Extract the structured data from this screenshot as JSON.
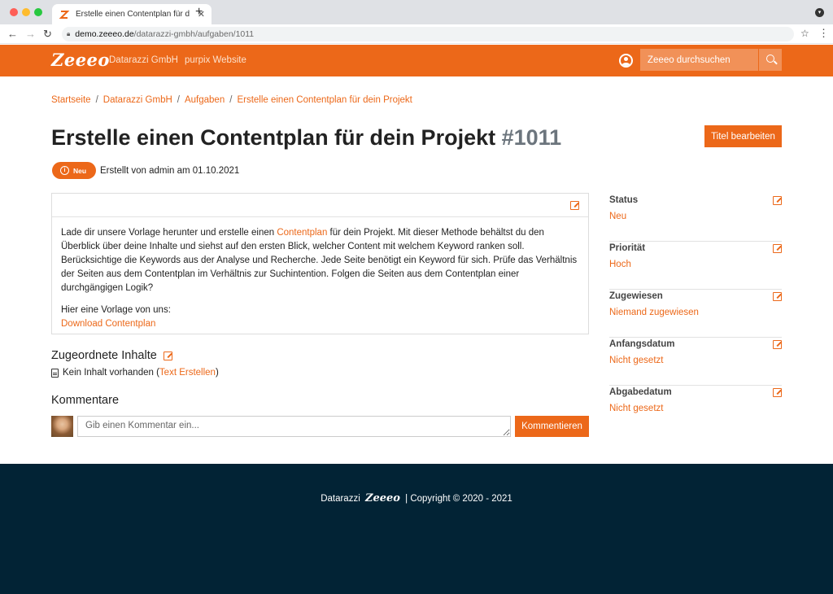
{
  "browser": {
    "tab_title": "Erstelle einen Contentplan für d",
    "tab_close": "✕",
    "new_tab": "+",
    "url_host": "demo.zeeeo.de",
    "url_path": "/datarazzi-gmbh/aufgaben/1011",
    "colors": {
      "close": "#fe5f57",
      "minimize": "#febc2e",
      "maximize": "#28c840"
    }
  },
  "header": {
    "logo": "Zeeeo",
    "nav": [
      "Datarazzi GmbH",
      "purpix Website"
    ],
    "search_placeholder": "Zeeeo durchsuchen",
    "accent_color": "#ec6819"
  },
  "breadcrumb": [
    "Startseite",
    "Datarazzi GmbH",
    "Aufgaben",
    "Erstelle einen Contentplan für dein Projekt"
  ],
  "task": {
    "title": "Erstelle einen Contentplan für dein Projekt",
    "number": "#1011",
    "edit_title_label": "Titel bearbeiten",
    "status_badge": "Neu",
    "created_text": "Erstellt von admin am 01.10.2021"
  },
  "description": {
    "intro_before": "Lade dir unsere Vorlage herunter und erstelle einen ",
    "intro_link": "Contentplan",
    "intro_after": " für dein Projekt. Mit dieser Methode behältst du den Überblick über deine Inhalte und siehst auf den ersten Blick, welcher Content mit welchem Keyword ranken soll. Berücksichtige die Keywords aus der Analyse und Recherche. Jede Seite benötigt ein Keyword für sich. Prüfe das Verhältnis der Seiten aus dem Contentplan im Verhältnis zur Suchintention. Folgen die Seiten aus dem Contentplan einer durchgängigen Logik?",
    "vorlage_text": "Hier eine Vorlage von uns:",
    "download_link": "Download Contentplan"
  },
  "inhalte": {
    "heading": "Zugeordnete Inhalte",
    "empty_text": "Kein Inhalt vorhanden (",
    "create_link": "Text Erstellen",
    "close_paren": ")"
  },
  "comments": {
    "heading": "Kommentare",
    "placeholder": "Gib einen Kommentar ein...",
    "submit_label": "Kommentieren"
  },
  "sidebar": [
    {
      "label": "Status",
      "value": "Neu"
    },
    {
      "label": "Priorität",
      "value": "Hoch"
    },
    {
      "label": "Zugewiesen",
      "value": "Niemand zugewiesen"
    },
    {
      "label": "Anfangsdatum",
      "value": "Nicht gesetzt"
    },
    {
      "label": "Abgabedatum",
      "value": "Nicht gesetzt"
    }
  ],
  "footer": {
    "company": "Datarazzi",
    "logo": "Zeeeo",
    "copyright": "| Copyright © 2020 - 2021"
  }
}
